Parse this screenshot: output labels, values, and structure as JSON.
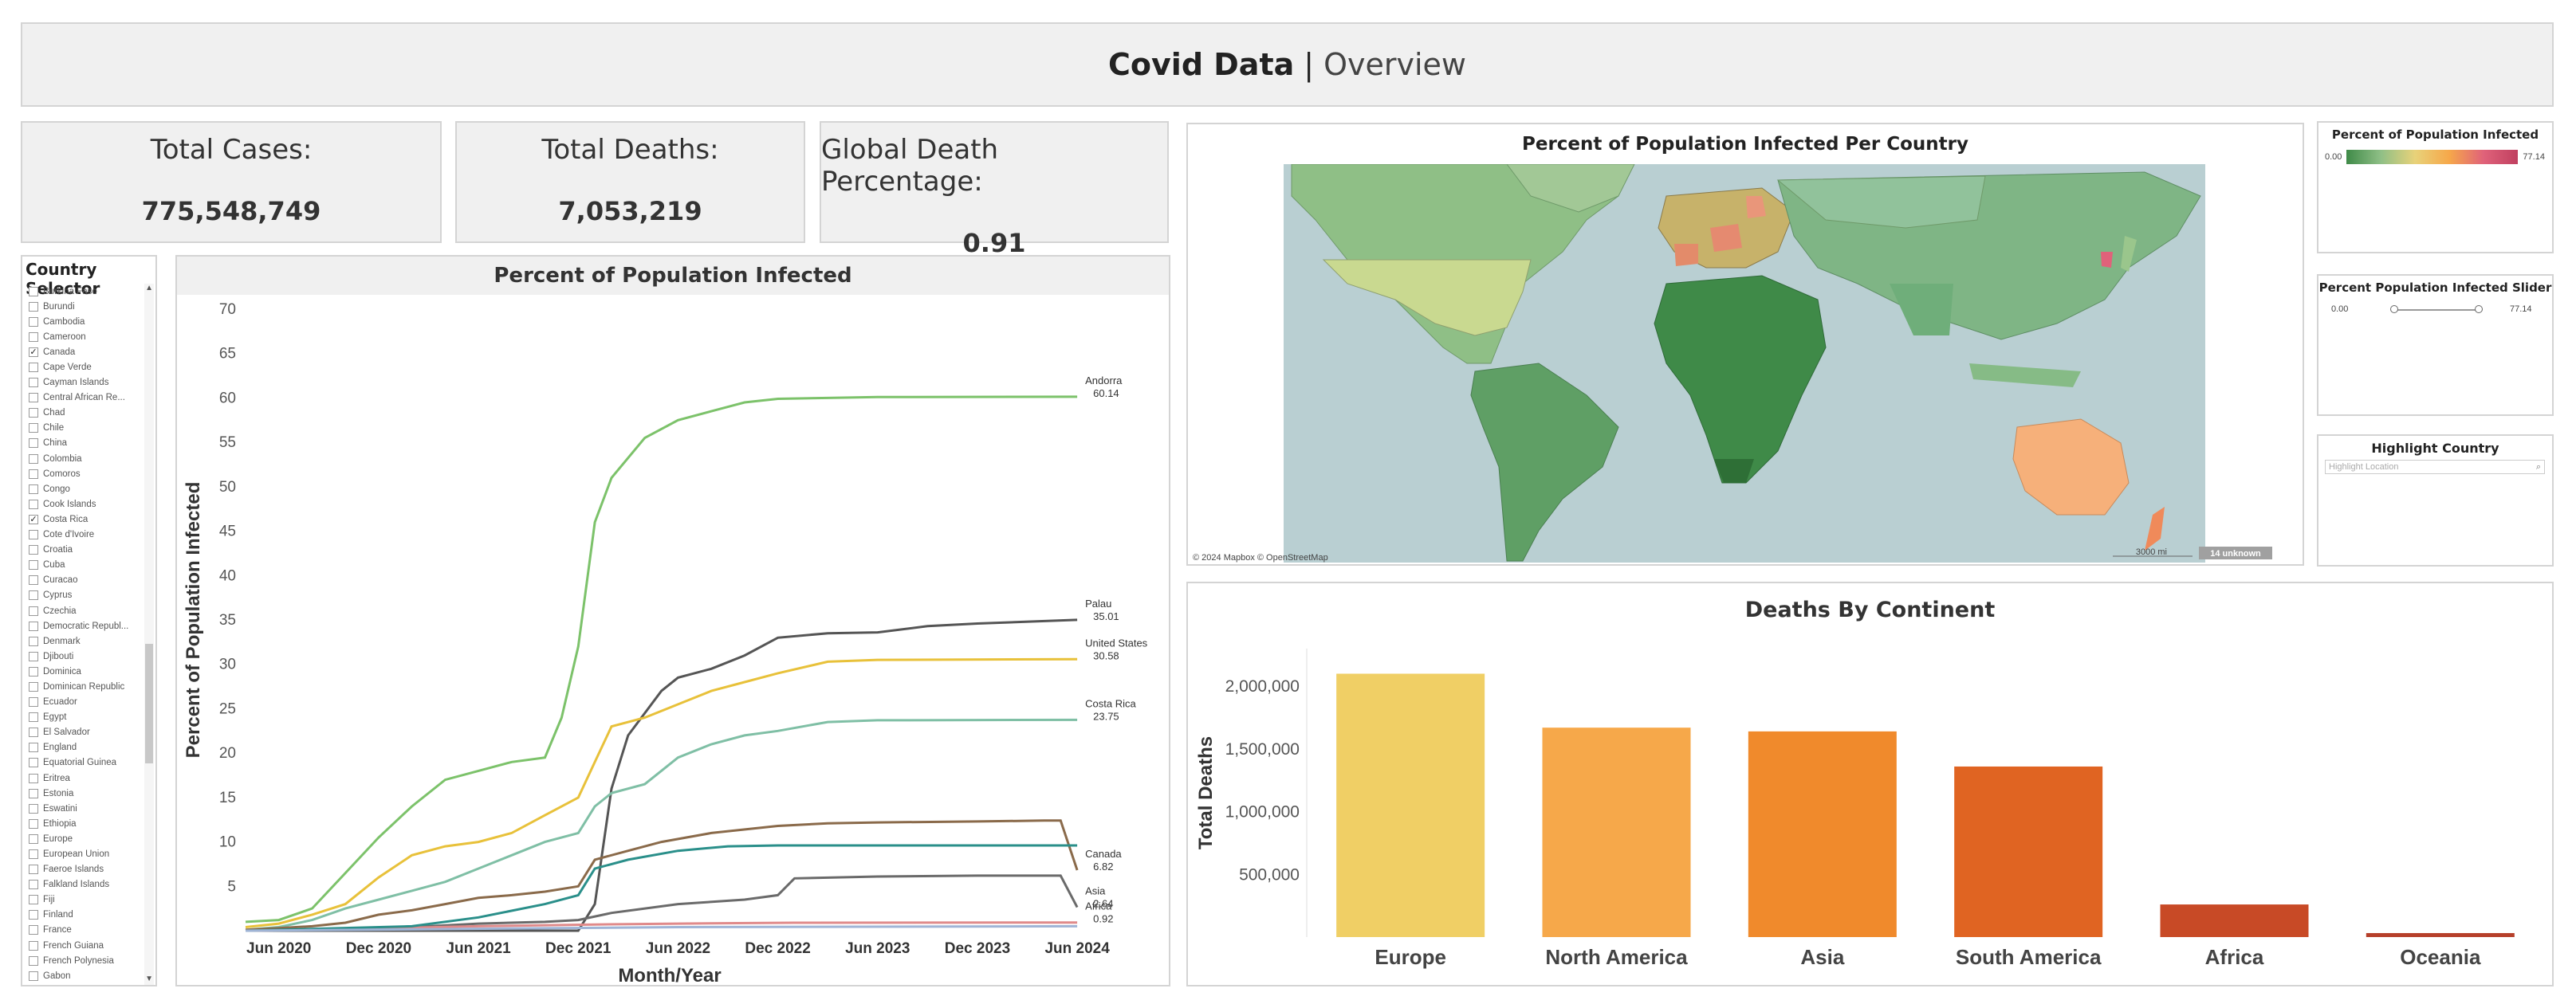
{
  "header": {
    "title": "Covid Data",
    "separator": "|",
    "subtitle": "Overview"
  },
  "kpis": {
    "total_cases": {
      "label": "Total Cases:",
      "value": "775,548,749"
    },
    "total_deaths": {
      "label": "Total Deaths:",
      "value": "7,053,219"
    },
    "global_death_pct": {
      "label": "Global Death Percentage:",
      "value": "0.91"
    }
  },
  "country_selector": {
    "title": "Country Selector",
    "items": [
      {
        "label": "Burkina Faso",
        "checked": false
      },
      {
        "label": "Burundi",
        "checked": false
      },
      {
        "label": "Cambodia",
        "checked": false
      },
      {
        "label": "Cameroon",
        "checked": false
      },
      {
        "label": "Canada",
        "checked": true
      },
      {
        "label": "Cape Verde",
        "checked": false
      },
      {
        "label": "Cayman Islands",
        "checked": false
      },
      {
        "label": "Central African Re...",
        "checked": false
      },
      {
        "label": "Chad",
        "checked": false
      },
      {
        "label": "Chile",
        "checked": false
      },
      {
        "label": "China",
        "checked": false
      },
      {
        "label": "Colombia",
        "checked": false
      },
      {
        "label": "Comoros",
        "checked": false
      },
      {
        "label": "Congo",
        "checked": false
      },
      {
        "label": "Cook Islands",
        "checked": false
      },
      {
        "label": "Costa Rica",
        "checked": true
      },
      {
        "label": "Cote d'Ivoire",
        "checked": false
      },
      {
        "label": "Croatia",
        "checked": false
      },
      {
        "label": "Cuba",
        "checked": false
      },
      {
        "label": "Curacao",
        "checked": false
      },
      {
        "label": "Cyprus",
        "checked": false
      },
      {
        "label": "Czechia",
        "checked": false
      },
      {
        "label": "Democratic Republ...",
        "checked": false
      },
      {
        "label": "Denmark",
        "checked": false
      },
      {
        "label": "Djibouti",
        "checked": false
      },
      {
        "label": "Dominica",
        "checked": false
      },
      {
        "label": "Dominican Republic",
        "checked": false
      },
      {
        "label": "Ecuador",
        "checked": false
      },
      {
        "label": "Egypt",
        "checked": false
      },
      {
        "label": "El Salvador",
        "checked": false
      },
      {
        "label": "England",
        "checked": false
      },
      {
        "label": "Equatorial Guinea",
        "checked": false
      },
      {
        "label": "Eritrea",
        "checked": false
      },
      {
        "label": "Estonia",
        "checked": false
      },
      {
        "label": "Eswatini",
        "checked": false
      },
      {
        "label": "Ethiopia",
        "checked": false
      },
      {
        "label": "Europe",
        "checked": false
      },
      {
        "label": "European Union",
        "checked": false
      },
      {
        "label": "Faeroe Islands",
        "checked": false
      },
      {
        "label": "Falkland Islands",
        "checked": false
      },
      {
        "label": "Fiji",
        "checked": false
      },
      {
        "label": "Finland",
        "checked": false
      },
      {
        "label": "France",
        "checked": false
      },
      {
        "label": "French Guiana",
        "checked": false
      },
      {
        "label": "French Polynesia",
        "checked": false
      },
      {
        "label": "Gabon",
        "checked": false
      }
    ]
  },
  "map": {
    "title": "Percent of Population Infected Per Country",
    "attribution": "© 2024 Mapbox © OpenStreetMap",
    "scale": "3000 mi",
    "unknown_badge": "14 unknown"
  },
  "legend": {
    "title": "Percent of Population Infected",
    "min": "0.00",
    "max": "77.14"
  },
  "slider": {
    "title": "Percent Population Infected Slider",
    "min": "0.00",
    "max": "77.14"
  },
  "highlight": {
    "title": "Highlight Country",
    "placeholder": "Highlight Location"
  },
  "colors": {
    "europe": "#f0cf65",
    "north_america": "#f6a84a",
    "asia": "#f08a2c",
    "south_america": "#e06422",
    "africa": "#c84a26",
    "oceania": "#b6402a"
  },
  "chart_data": [
    {
      "type": "line",
      "title": "Percent of Population Infected",
      "xlabel": "Month/Year",
      "ylabel": "Percent of Population Infected",
      "ylim": [
        0,
        70
      ],
      "yticks": [
        5,
        10,
        15,
        20,
        25,
        30,
        35,
        40,
        45,
        50,
        55,
        60,
        65,
        70
      ],
      "xlim": [
        "2020-04",
        "2024-07"
      ],
      "xticks": [
        {
          "x": "2020-06",
          "label": "Jun 2020"
        },
        {
          "x": "2020-12",
          "label": "Dec 2020"
        },
        {
          "x": "2021-06",
          "label": "Jun 2021"
        },
        {
          "x": "2021-12",
          "label": "Dec 2021"
        },
        {
          "x": "2022-06",
          "label": "Jun 2022"
        },
        {
          "x": "2022-12",
          "label": "Dec 2022"
        },
        {
          "x": "2023-06",
          "label": "Jun 2023"
        },
        {
          "x": "2023-12",
          "label": "Dec 2023"
        },
        {
          "x": "2024-06",
          "label": "Jun 2024"
        }
      ],
      "series": [
        {
          "name": "Andorra",
          "end_label": "60.14",
          "color": "#7cc26a",
          "points": [
            [
              "2020-04",
              1
            ],
            [
              "2020-06",
              1.2
            ],
            [
              "2020-08",
              2.5
            ],
            [
              "2020-10",
              6.5
            ],
            [
              "2020-12",
              10.5
            ],
            [
              "2021-02",
              14
            ],
            [
              "2021-04",
              17
            ],
            [
              "2021-06",
              18
            ],
            [
              "2021-08",
              19
            ],
            [
              "2021-10",
              19.5
            ],
            [
              "2021-11",
              24
            ],
            [
              "2021-12",
              32
            ],
            [
              "2022-01",
              46
            ],
            [
              "2022-02",
              51
            ],
            [
              "2022-04",
              55.5
            ],
            [
              "2022-06",
              57.5
            ],
            [
              "2022-08",
              58.5
            ],
            [
              "2022-10",
              59.5
            ],
            [
              "2022-12",
              59.9
            ],
            [
              "2023-03",
              60
            ],
            [
              "2023-06",
              60.1
            ],
            [
              "2024-06",
              60.14
            ]
          ]
        },
        {
          "name": "Palau",
          "end_label": "35.01",
          "color": "#555555",
          "points": [
            [
              "2020-04",
              0
            ],
            [
              "2021-12",
              0
            ],
            [
              "2022-01",
              3
            ],
            [
              "2022-02",
              16
            ],
            [
              "2022-03",
              22
            ],
            [
              "2022-05",
              27
            ],
            [
              "2022-06",
              28.5
            ],
            [
              "2022-08",
              29.5
            ],
            [
              "2022-10",
              31
            ],
            [
              "2022-12",
              33
            ],
            [
              "2023-03",
              33.5
            ],
            [
              "2023-06",
              33.6
            ],
            [
              "2023-09",
              34.3
            ],
            [
              "2023-12",
              34.6
            ],
            [
              "2024-06",
              35.01
            ]
          ]
        },
        {
          "name": "United States",
          "end_label": "30.58",
          "color": "#e8c13a",
          "points": [
            [
              "2020-04",
              0.4
            ],
            [
              "2020-06",
              0.8
            ],
            [
              "2020-08",
              1.8
            ],
            [
              "2020-10",
              3
            ],
            [
              "2020-12",
              6
            ],
            [
              "2021-02",
              8.5
            ],
            [
              "2021-04",
              9.5
            ],
            [
              "2021-06",
              10
            ],
            [
              "2021-08",
              11
            ],
            [
              "2021-10",
              13
            ],
            [
              "2021-12",
              15
            ],
            [
              "2022-01",
              19
            ],
            [
              "2022-02",
              23
            ],
            [
              "2022-04",
              24
            ],
            [
              "2022-06",
              25.5
            ],
            [
              "2022-08",
              27
            ],
            [
              "2022-10",
              28
            ],
            [
              "2022-12",
              29
            ],
            [
              "2023-03",
              30.3
            ],
            [
              "2023-06",
              30.5
            ],
            [
              "2024-06",
              30.58
            ]
          ]
        },
        {
          "name": "Costa Rica",
          "end_label": "23.75",
          "color": "#7fbfa5",
          "points": [
            [
              "2020-04",
              0.1
            ],
            [
              "2020-06",
              0.4
            ],
            [
              "2020-08",
              1.2
            ],
            [
              "2020-10",
              2.5
            ],
            [
              "2020-12",
              3.5
            ],
            [
              "2021-02",
              4.5
            ],
            [
              "2021-04",
              5.5
            ],
            [
              "2021-06",
              7
            ],
            [
              "2021-08",
              8.5
            ],
            [
              "2021-10",
              10
            ],
            [
              "2021-12",
              11
            ],
            [
              "2022-01",
              14
            ],
            [
              "2022-02",
              15.5
            ],
            [
              "2022-04",
              16.5
            ],
            [
              "2022-06",
              19.5
            ],
            [
              "2022-08",
              21
            ],
            [
              "2022-10",
              22
            ],
            [
              "2022-12",
              22.5
            ],
            [
              "2023-03",
              23.5
            ],
            [
              "2023-06",
              23.7
            ],
            [
              "2024-06",
              23.75
            ]
          ]
        },
        {
          "name": "Canada",
          "end_label": "6.82",
          "color": "#8a6a4a",
          "points": [
            [
              "2020-04",
              0.1
            ],
            [
              "2020-06",
              0.3
            ],
            [
              "2020-08",
              0.5
            ],
            [
              "2020-10",
              0.9
            ],
            [
              "2020-12",
              1.8
            ],
            [
              "2021-02",
              2.3
            ],
            [
              "2021-04",
              3
            ],
            [
              "2021-06",
              3.7
            ],
            [
              "2021-08",
              4
            ],
            [
              "2021-10",
              4.4
            ],
            [
              "2021-12",
              5
            ],
            [
              "2022-01",
              8
            ],
            [
              "2022-03",
              9
            ],
            [
              "2022-05",
              10
            ],
            [
              "2022-08",
              11
            ],
            [
              "2022-12",
              11.8
            ],
            [
              "2023-03",
              12.1
            ],
            [
              "2023-06",
              12.2
            ],
            [
              "2023-12",
              12.3
            ],
            [
              "2024-04",
              12.4
            ],
            [
              "2024-05",
              12.4
            ],
            [
              "2024-06",
              6.82
            ]
          ]
        },
        {
          "name": "Asia",
          "end_label": "2.64",
          "color": "#6a6a6a",
          "points": [
            [
              "2020-04",
              0
            ],
            [
              "2020-06",
              0.1
            ],
            [
              "2020-10",
              0.2
            ],
            [
              "2021-02",
              0.4
            ],
            [
              "2021-06",
              0.8
            ],
            [
              "2021-10",
              1
            ],
            [
              "2021-12",
              1.2
            ],
            [
              "2022-02",
              2
            ],
            [
              "2022-06",
              3
            ],
            [
              "2022-10",
              3.5
            ],
            [
              "2022-12",
              4
            ],
            [
              "2023-01",
              5.9
            ],
            [
              "2023-06",
              6.1
            ],
            [
              "2023-12",
              6.2
            ],
            [
              "2024-05",
              6.2
            ],
            [
              "2024-06",
              2.64
            ]
          ]
        },
        {
          "name": "Africa",
          "end_label": "0.92",
          "color": "#e08a8a",
          "points": [
            [
              "2020-04",
              0
            ],
            [
              "2020-08",
              0.1
            ],
            [
              "2021-01",
              0.3
            ],
            [
              "2021-06",
              0.5
            ],
            [
              "2022-01",
              0.7
            ],
            [
              "2022-06",
              0.8
            ],
            [
              "2023-01",
              0.9
            ],
            [
              "2024-06",
              0.92
            ]
          ]
        },
        {
          "name": "",
          "end_label": "",
          "color": "#2a8f8a",
          "points": [
            [
              "2020-04",
              0
            ],
            [
              "2021-02",
              0.5
            ],
            [
              "2021-06",
              1.5
            ],
            [
              "2021-10",
              3
            ],
            [
              "2021-12",
              4
            ],
            [
              "2022-01",
              7
            ],
            [
              "2022-03",
              8
            ],
            [
              "2022-06",
              9
            ],
            [
              "2022-09",
              9.5
            ],
            [
              "2022-12",
              9.6
            ],
            [
              "2024-06",
              9.6
            ]
          ]
        },
        {
          "name": "",
          "end_label": "",
          "color": "#9fb4d6",
          "points": [
            [
              "2020-04",
              0
            ],
            [
              "2022-06",
              0.4
            ],
            [
              "2024-06",
              0.5
            ]
          ]
        }
      ]
    },
    {
      "type": "bar",
      "title": "Deaths By Continent",
      "ylabel": "Total Deaths",
      "xlabel": "",
      "categories": [
        "Europe",
        "North America",
        "Asia",
        "South America",
        "Africa",
        "Oceania"
      ],
      "values": [
        2100000,
        1670000,
        1640000,
        1360000,
        260000,
        32000
      ],
      "ylim": [
        0,
        2300000
      ],
      "yticks": [
        {
          "v": 500000,
          "label": "500,000"
        },
        {
          "v": 1000000,
          "label": "1,000,000"
        },
        {
          "v": 1500000,
          "label": "1,500,000"
        },
        {
          "v": 2000000,
          "label": "2,000,000"
        }
      ]
    }
  ]
}
